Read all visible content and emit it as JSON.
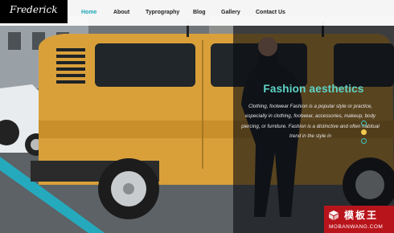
{
  "brand": {
    "logo": "Frederick"
  },
  "nav": {
    "items": [
      {
        "label": "Home",
        "active": true
      },
      {
        "label": "About",
        "active": false
      },
      {
        "label": "Typrography",
        "active": false
      },
      {
        "label": "Blog",
        "active": false
      },
      {
        "label": "Gallery",
        "active": false
      },
      {
        "label": "Contact Us",
        "active": false
      }
    ]
  },
  "hero": {
    "title": "Fashion aesthetics",
    "text": "Clothing, footwear Fashion is a popular style or practice, especially in clothing, footwear, accessories, makeup, body piercing, or furniture. Fashion is a distinctive and often habitual trend in the style in",
    "slides": 3,
    "active_slide": 2
  },
  "watermark": {
    "cn": "模板王",
    "en": "MOBANWANG.COM"
  },
  "colors": {
    "accent": "#1aa6b7",
    "title": "#5fd6c9",
    "van": "#d9a03a",
    "dot_active": "#f2c94c"
  }
}
